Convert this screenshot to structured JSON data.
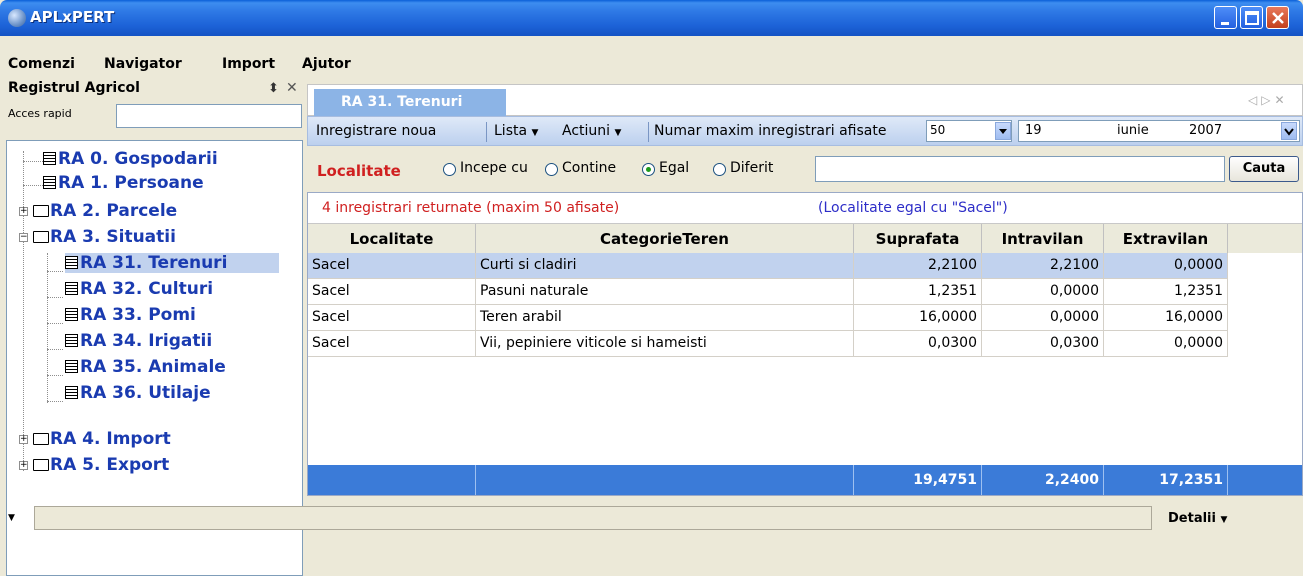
{
  "window": {
    "title": "APLxPERT"
  },
  "menu": [
    "Comenzi",
    "Navigator",
    "Import",
    "Ajutor"
  ],
  "left_panel": {
    "title": "Registrul Agricol",
    "pin_icon": "pin-icon",
    "close_icon": "close-icon",
    "acces_label": "Acces rapid",
    "acces_value": "",
    "tree": [
      {
        "label": "RA 0. Gospodarii",
        "type": "doc"
      },
      {
        "label": "RA 1. Persoane",
        "type": "doc"
      },
      {
        "label": "RA 2. Parcele",
        "type": "folder",
        "state": "collapsed"
      },
      {
        "label": "RA 3. Situatii",
        "type": "folder",
        "state": "expanded"
      },
      {
        "label": "RA 31. Terenuri",
        "type": "doc",
        "selected": true
      },
      {
        "label": "RA 32. Culturi",
        "type": "doc"
      },
      {
        "label": "RA 33. Pomi",
        "type": "doc"
      },
      {
        "label": "RA 34. Irigatii",
        "type": "doc"
      },
      {
        "label": "RA 35. Animale",
        "type": "doc"
      },
      {
        "label": "RA 36. Utilaje",
        "type": "doc"
      },
      {
        "label": "RA 4. Import",
        "type": "folder",
        "state": "collapsed"
      },
      {
        "label": "RA 5. Export",
        "type": "folder",
        "state": "collapsed"
      }
    ]
  },
  "tab": {
    "label": "RA 31. Terenuri"
  },
  "toolbar": {
    "new_record": "Inregistrare noua",
    "list": "Lista",
    "actions": "Actiuni",
    "max_label": "Numar maxim inregistrari afisate",
    "max_value": "50",
    "date_day": "19",
    "date_month": "iunie",
    "date_year": "2007"
  },
  "filter": {
    "field_label": "Localitate",
    "options": [
      "Incepe cu",
      "Contine",
      "Egal",
      "Diferit"
    ],
    "selected": "Egal",
    "value": "",
    "button": "Cauta"
  },
  "grid": {
    "status_count": "4 inregistrari returnate (maxim 50 afisate)",
    "status_filter": "(Localitate egal cu \"Sacel\")",
    "columns": [
      "Localitate",
      "CategorieTeren",
      "Suprafata",
      "Intravilan",
      "Extravilan"
    ],
    "rows": [
      [
        "Sacel",
        "Curti si cladiri",
        "2,2100",
        "2,2100",
        "0,0000"
      ],
      [
        "Sacel",
        "Pasuni naturale",
        "1,2351",
        "0,0000",
        "1,2351"
      ],
      [
        "Sacel",
        "Teren arabil",
        "16,0000",
        "0,0000",
        "16,0000"
      ],
      [
        "Sacel",
        "Vii, pepiniere viticole si hameisti",
        "0,0300",
        "0,0300",
        "0,0000"
      ]
    ],
    "totals": [
      "",
      "",
      "19,4751",
      "2,2400",
      "17,2351"
    ]
  },
  "bottom": {
    "detalii": "Detalii"
  },
  "colors": {
    "title_bar": "#2f7ae6",
    "accent_red": "#d02020",
    "selection": "#c1d2ee",
    "totals_row": "#3b7bd8"
  }
}
